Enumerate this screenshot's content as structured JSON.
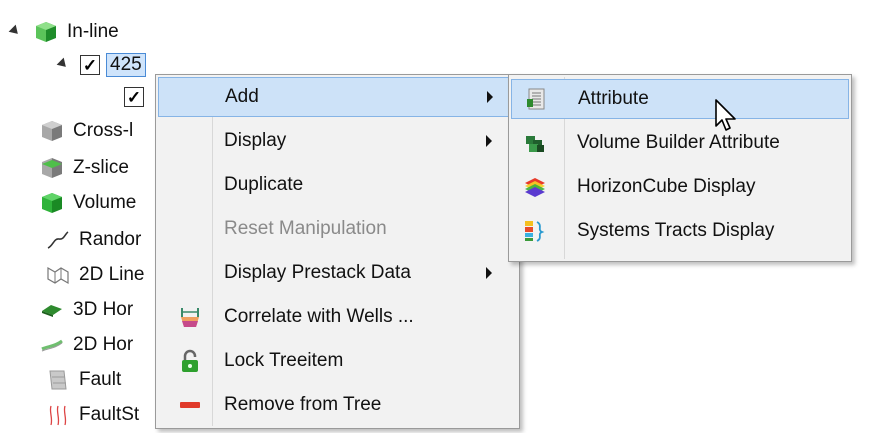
{
  "tree": {
    "items": [
      {
        "label": "In-line",
        "icon": "inline-cube-icon"
      },
      {
        "label": "425",
        "checked": true,
        "icon": "checkbox"
      },
      {
        "label": "",
        "checked": true
      },
      {
        "label": "Cross-l",
        "icon": "crossline-cube-icon"
      },
      {
        "label": "Z-slice",
        "icon": "zslice-cube-icon"
      },
      {
        "label": "Volume",
        "icon": "volume-cube-icon"
      },
      {
        "label": "Randor",
        "icon": "random-line-icon"
      },
      {
        "label": "2D Line",
        "icon": "2d-line-icon"
      },
      {
        "label": "3D Hor",
        "icon": "3d-horizon-icon"
      },
      {
        "label": "2D Hor",
        "icon": "2d-horizon-icon"
      },
      {
        "label": "Fault",
        "icon": "fault-icon"
      },
      {
        "label": "FaultSt",
        "icon": "faultstickset-icon"
      }
    ]
  },
  "context_menu": {
    "items": [
      {
        "label": "Add",
        "submenu": true,
        "highlighted": true
      },
      {
        "label": "Display",
        "submenu": true
      },
      {
        "label": "Duplicate"
      },
      {
        "label": "Reset Manipulation",
        "disabled": true
      },
      {
        "label": "Display Prestack Data",
        "submenu": true
      },
      {
        "label": "Correlate with Wells ...",
        "icon": "correlate-wells-icon"
      },
      {
        "label": "Lock Treeitem",
        "icon": "lock-icon"
      },
      {
        "label": "Remove from Tree",
        "icon": "remove-icon"
      }
    ]
  },
  "submenu": {
    "items": [
      {
        "label": "Attribute",
        "icon": "attribute-icon",
        "highlighted": true
      },
      {
        "label": "Volume Builder Attribute",
        "icon": "volume-builder-icon"
      },
      {
        "label": "HorizonCube Display",
        "icon": "horizoncube-icon"
      },
      {
        "label": "Systems Tracts Display",
        "icon": "systems-tracts-icon"
      }
    ]
  },
  "colors": {
    "highlight": "#cde2f8",
    "highlight_border": "#86b4e6",
    "menu_bg": "#f2f2f2"
  }
}
